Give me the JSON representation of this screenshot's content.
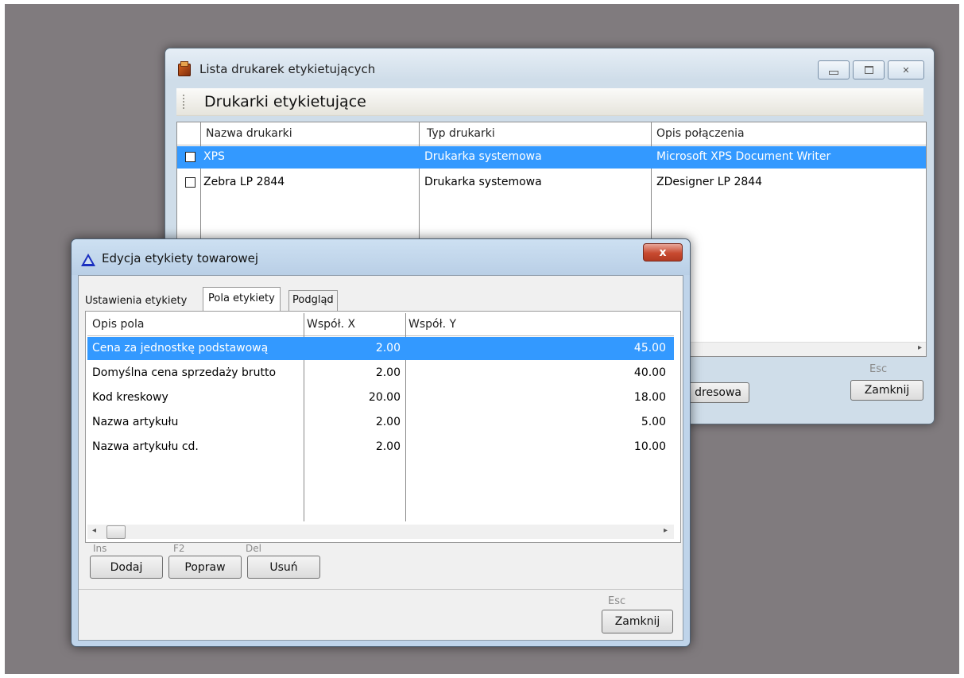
{
  "printer_list_window": {
    "title": "Lista drukarek etykietujących",
    "section_title": "Drukarki etykietujące",
    "columns": [
      "Nazwa drukarki",
      "Typ drukarki",
      "Opis połączenia"
    ],
    "rows": [
      {
        "name": "XPS",
        "type": "Drukarka systemowa",
        "connection": "Microsoft XPS Document Writer",
        "selected": true
      },
      {
        "name": "Zebra LP 2844",
        "type": "Drukarka systemowa",
        "connection": "ZDesigner LP 2844",
        "selected": false
      }
    ],
    "partial_button_label": "dresowa",
    "close_shortcut": "Esc",
    "close_button": "Zamknij"
  },
  "label_edit_dialog": {
    "title": "Edycja etykiety towarowej",
    "close_glyph": "x",
    "tabs": [
      {
        "label": "Ustawienia etykiety",
        "active": false
      },
      {
        "label": "Pola etykiety",
        "active": true
      },
      {
        "label": "Podgląd",
        "active": false
      }
    ],
    "columns": [
      "Opis pola",
      "Współ. X",
      "Współ. Y"
    ],
    "rows": [
      {
        "field": "Cena za jednostkę podstawową",
        "x": "2.00",
        "y": "45.00",
        "selected": true
      },
      {
        "field": "Domyślna cena sprzedaży brutto",
        "x": "2.00",
        "y": "40.00",
        "selected": false
      },
      {
        "field": "Kod kreskowy",
        "x": "20.00",
        "y": "18.00",
        "selected": false
      },
      {
        "field": "Nazwa artykułu",
        "x": "2.00",
        "y": "5.00",
        "selected": false
      },
      {
        "field": "Nazwa artykułu cd.",
        "x": "2.00",
        "y": "10.00",
        "selected": false
      }
    ],
    "actions": [
      {
        "shortcut": "Ins",
        "label": "Dodaj"
      },
      {
        "shortcut": "F2",
        "label": "Popraw"
      },
      {
        "shortcut": "Del",
        "label": "Usuń"
      }
    ],
    "close_shortcut": "Esc",
    "close_button": "Zamknij"
  },
  "colors": {
    "selection": "#3399ff",
    "desktop": "#807b7e",
    "frame": "#bfd4ea"
  }
}
